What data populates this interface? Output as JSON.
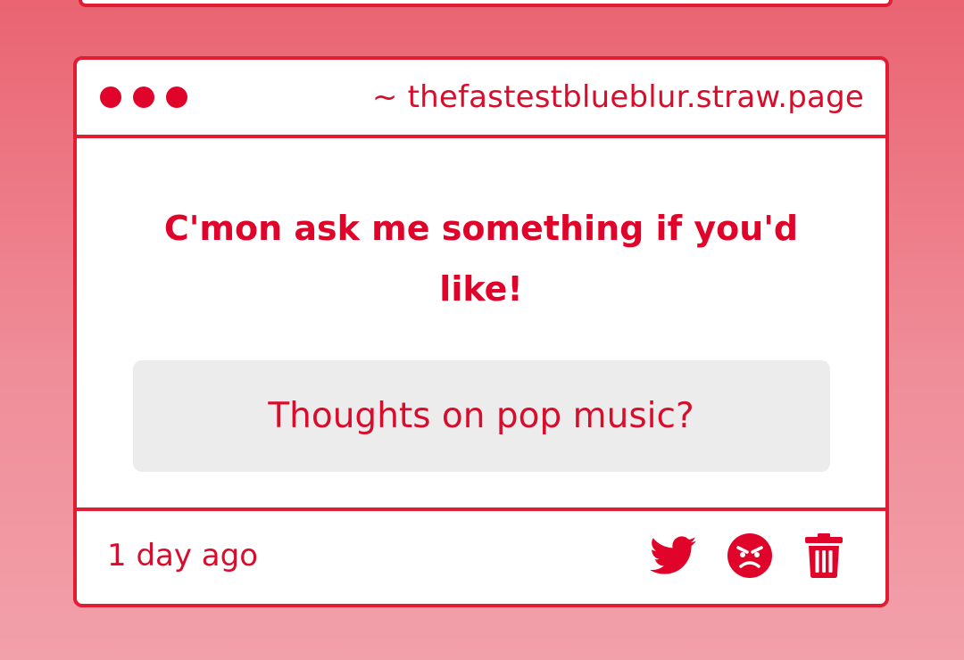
{
  "window": {
    "url_text": "~ thefastestblueblur.straw.page"
  },
  "post": {
    "prompt": "C'mon ask me something if you'd like!",
    "question": "Thoughts on pop music?",
    "timestamp": "1 day ago"
  },
  "actions": [
    {
      "icon": "twitter-icon"
    },
    {
      "icon": "angry-face-icon"
    },
    {
      "icon": "trash-icon"
    }
  ],
  "colors": {
    "accent": "#e0042a",
    "card_background": "#ffffff",
    "question_background": "#ececed",
    "page_gradient_top": "#ea6472",
    "page_gradient_bottom": "#f2a0aa"
  }
}
